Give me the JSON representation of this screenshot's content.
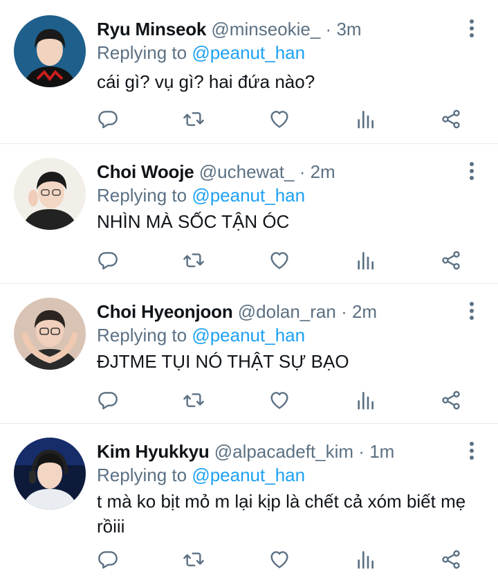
{
  "tweets": [
    {
      "name": "Ryu Minseok",
      "handle": "@minseokie_",
      "time": "3m",
      "replying_prefix": "Replying to",
      "replying_to": "@peanut_han",
      "text": "cái gì? vụ gì? hai đứa nào?"
    },
    {
      "name": "Choi Wooje",
      "handle": "@uchewat_",
      "time": "2m",
      "replying_prefix": "Replying to",
      "replying_to": "@peanut_han",
      "text": "NHÌN MÀ SỐC TẬN ÓC"
    },
    {
      "name": "Choi Hyeonjoon",
      "handle": "@dolan_ran",
      "time": "2m",
      "replying_prefix": "Replying to",
      "replying_to": "@peanut_han",
      "text": "ĐJTME TỤI NÓ THẬT SỰ BẠO"
    },
    {
      "name": "Kim Hyukkyu",
      "handle": "@alpacadeft_kim",
      "time": "1m",
      "replying_prefix": "Replying to",
      "replying_to": "@peanut_han",
      "text": "t mà ko bịt mỏ m lại kịp là chết cả xóm biết mẹ rồiii"
    }
  ],
  "separator": "·",
  "icons": {
    "reply": "reply-icon",
    "retweet": "retweet-icon",
    "like": "like-icon",
    "stats": "stats-icon",
    "share": "share-icon",
    "more": "more-icon"
  },
  "colors": {
    "link": "#1da1f2",
    "secondary": "#5b7083",
    "text": "#0f1419",
    "divider": "#e6ecf0"
  }
}
